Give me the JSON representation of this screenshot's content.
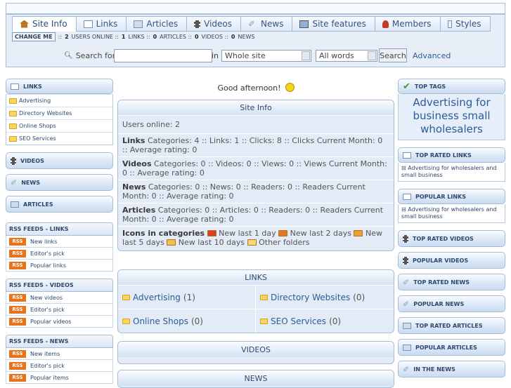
{
  "nav": {
    "tabs": [
      {
        "label": "Site Info",
        "icon": "home-icon",
        "active": true
      },
      {
        "label": "Links",
        "icon": "links-icon"
      },
      {
        "label": "Articles",
        "icon": "articles-icon"
      },
      {
        "label": "Videos",
        "icon": "film-icon"
      },
      {
        "label": "News",
        "icon": "pen-icon"
      },
      {
        "label": "Site features",
        "icon": "features-icon"
      },
      {
        "label": "Members",
        "icon": "members-icon"
      },
      {
        "label": "Styles",
        "icon": "styles-icon"
      }
    ]
  },
  "infobar": {
    "change_label": "CHANGE ME",
    "sep": "::",
    "users": "2",
    "users_label": "USERS ONLINE ::",
    "links": "1",
    "links_label": "LINKS ::",
    "articles": "0",
    "articles_label": "ARTICLES ::",
    "videos": "0",
    "videos_label": "VIDEOS ::",
    "news": "0",
    "news_label": "NEWS"
  },
  "search": {
    "label": "Search for",
    "value": "",
    "in_label": "in",
    "scope": "Whole site",
    "mode": "All words",
    "button": "Search",
    "advanced": "Advanced"
  },
  "left": {
    "links_title": "LINKS",
    "links_items": [
      "Advertising",
      "Directory Websites",
      "Online Shops",
      "SEO Services"
    ],
    "videos_title": "VIDEOS",
    "news_title": "NEWS",
    "articles_title": "ARTICLES",
    "rss_badge": "RSS",
    "rss_links_title": "RSS FEEDS - LINKS",
    "rss_links": [
      "New links",
      "Editor's pick",
      "Popular links"
    ],
    "rss_videos_title": "RSS FEEDS - VIDEOS",
    "rss_videos": [
      "New videos",
      "Editor's pick",
      "Popular videos"
    ],
    "rss_news_title": "RSS FEEDS - NEWS",
    "rss_news": [
      "New items",
      "Editor's pick",
      "Popular items"
    ]
  },
  "main": {
    "greeting": "Good afternoon!",
    "siteinfo_title": "Site Info",
    "users_online": "Users online: 2",
    "links_label": "Links",
    "links_text": "Categories: 4 :: Links: 1 :: Clicks: 8 :: Clicks Current Month: 0 :: Average rating: 0",
    "videos_label": "Videos",
    "videos_text": "Categories: 0 :: Videos: 0 :: Views: 0 :: Views Current Month: 0 :: Average rating: 0",
    "news_label": "News",
    "news_text": "Categories: 0 :: News: 0 :: Readers: 0 :: Readers Current Month: 0 :: Average rating: 0",
    "articles_label": "Articles",
    "articles_text": "Categories: 0 :: Articles: 0 :: Readers: 0 :: Readers Current Month: 0 :: Average rating: 0",
    "icons_label": "Icons in categories",
    "legend": [
      "New last 1 day",
      "New last 2 days",
      "New last 5 days",
      "New last 10 days",
      "Other folders"
    ],
    "legend_colors": [
      "#d9411e",
      "#e07a22",
      "#e8a233",
      "#f0c24a",
      "#f6da7a"
    ],
    "links_panel_title": "LINKS",
    "categories": [
      {
        "name": "Advertising",
        "count": "(1)"
      },
      {
        "name": "Directory Websites",
        "count": "(0)"
      },
      {
        "name": "Online Shops",
        "count": "(0)"
      },
      {
        "name": "SEO Services",
        "count": "(0)"
      }
    ],
    "videos_panel_title": "VIDEOS",
    "news_panel_title": "NEWS"
  },
  "right": {
    "top_tags_title": "TOP TAGS",
    "top_tags_text": "Advertising for business small wholesalers",
    "top_rated_links_title": "TOP RATED LINKS",
    "top_rated_links_item": "Advertising for wholesalers and small business",
    "popular_links_title": "POPULAR LINKS",
    "popular_links_item": "Advertising for wholesalers and small business",
    "top_rated_videos_title": "TOP RATED VIDEOS",
    "popular_videos_title": "POPULAR VIDEOS",
    "top_rated_news_title": "TOP RATED NEWS",
    "popular_news_title": "POPULAR NEWS",
    "top_rated_articles_title": "TOP RATED ARTICLES",
    "popular_articles_title": "POPULAR ARTICLES",
    "in_the_news_title": "IN THE NEWS"
  }
}
